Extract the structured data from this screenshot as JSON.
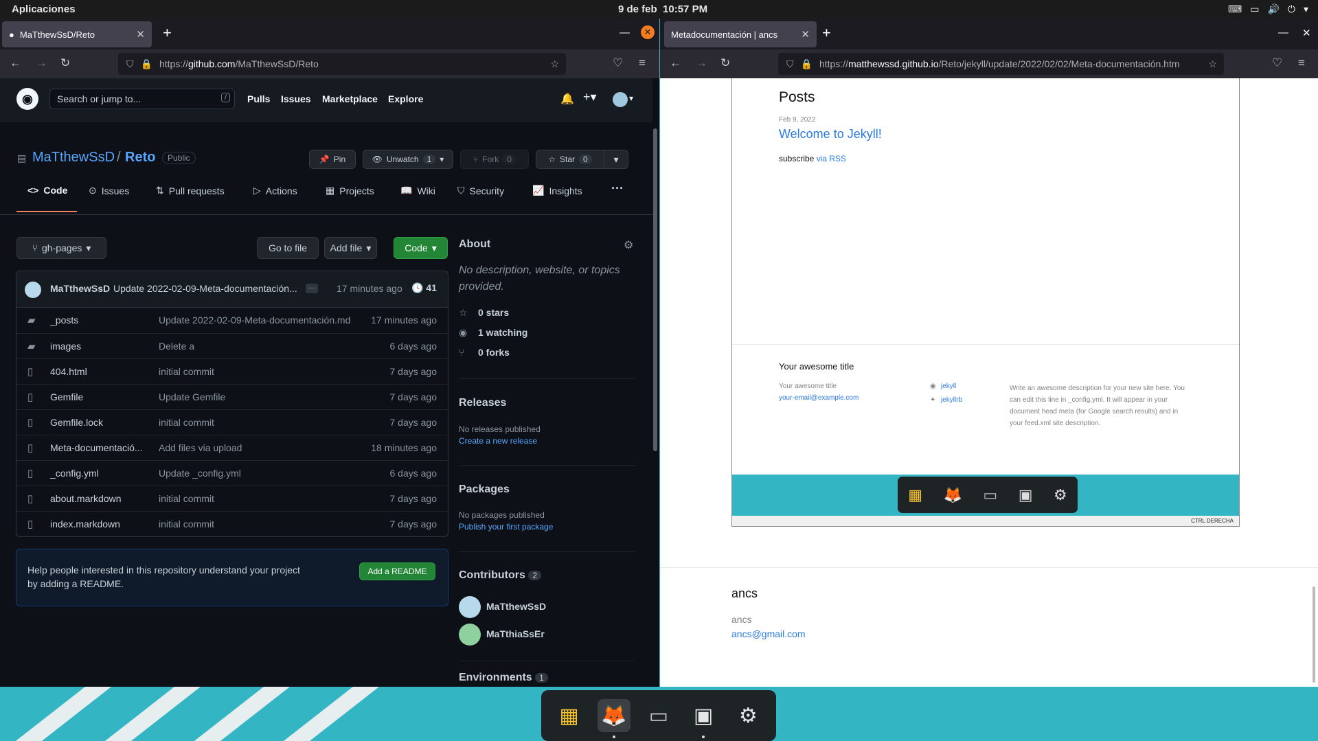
{
  "topbar": {
    "apps": "Aplicaciones",
    "date": "9 de feb",
    "time": "10:57 PM"
  },
  "left_browser": {
    "tab_title": "MaTthewSsD/Reto",
    "url_prefix": "https://",
    "url_host": "github.com",
    "url_path": "/MaTthewSsD/Reto"
  },
  "right_browser": {
    "tab_title": "Metadocumentación | ancs",
    "url_prefix": "https://",
    "url_host": "matthewssd.github.io",
    "url_path": "/Reto/jekyll/update/2022/02/02/Meta-documentación.htm"
  },
  "github": {
    "search_placeholder": "Search or jump to...",
    "search_key": "/",
    "nav": [
      "Pulls",
      "Issues",
      "Marketplace",
      "Explore"
    ],
    "owner": "MaTthewSsD",
    "repo": "Reto",
    "visibility": "Public",
    "pin": "Pin",
    "unwatch": "Unwatch",
    "unwatch_count": "1",
    "fork": "Fork",
    "fork_count": "0",
    "star": "Star",
    "star_count": "0",
    "tabs": [
      "Code",
      "Issues",
      "Pull requests",
      "Actions",
      "Projects",
      "Wiki",
      "Security",
      "Insights"
    ],
    "more": "···",
    "branch": "gh-pages",
    "goto_file": "Go to file",
    "add_file": "Add file",
    "code": "Code",
    "commit": {
      "author": "MaTthewSsD",
      "message": "Update 2022-02-09-Meta-documentación...",
      "dots": "···",
      "age": "17 minutes ago",
      "count": "41"
    },
    "files": [
      {
        "type": "folder",
        "name": "_posts",
        "message": "Update 2022-02-09-Meta-documentación.md",
        "age": "17 minutes ago"
      },
      {
        "type": "folder",
        "name": "images",
        "message": "Delete a",
        "age": "6 days ago"
      },
      {
        "type": "file",
        "name": "404.html",
        "message": "initial commit",
        "age": "7 days ago"
      },
      {
        "type": "file",
        "name": "Gemfile",
        "message": "Update Gemfile",
        "age": "7 days ago"
      },
      {
        "type": "file",
        "name": "Gemfile.lock",
        "message": "initial commit",
        "age": "7 days ago"
      },
      {
        "type": "file",
        "name": "Meta-documentació...",
        "message": "Add files via upload",
        "age": "18 minutes ago"
      },
      {
        "type": "file",
        "name": "_config.yml",
        "message": "Update _config.yml",
        "age": "6 days ago"
      },
      {
        "type": "file",
        "name": "about.markdown",
        "message": "initial commit",
        "age": "7 days ago"
      },
      {
        "type": "file",
        "name": "index.markdown",
        "message": "initial commit",
        "age": "7 days ago"
      }
    ],
    "readme_prompt": "Help people interested in this repository understand your project by adding a README.",
    "add_readme": "Add a README",
    "about": {
      "title": "About",
      "description": "No description, website, or topics provided.",
      "stars": "0 stars",
      "watching": "1 watching",
      "forks": "0 forks"
    },
    "releases": {
      "title": "Releases",
      "none": "No releases published",
      "link": "Create a new release"
    },
    "packages": {
      "title": "Packages",
      "none": "No packages published",
      "link": "Publish your first package"
    },
    "contributors": {
      "title": "Contributors",
      "count": "2",
      "people": [
        "MaTthewSsD",
        "MaTthiaSsEr"
      ]
    },
    "environments": {
      "title": "Environments",
      "count": "1"
    }
  },
  "jekyll": {
    "posts_title": "Posts",
    "post_date": "Feb 9, 2022",
    "post_title": "Welcome to Jekyll!",
    "subscribe": "subscribe",
    "via_rss": "via RSS",
    "footer_title": "Your awesome title",
    "footer_name": "Your awesome title",
    "footer_email": "your-email@example.com",
    "github_user": "jekyll",
    "twitter_user": "jekyllrb",
    "footer_desc": "Write an awesome description for your new site here. You can edit this line in _config.yml. It will appear in your document head meta (for Google search results) and in your feed.xml site description.",
    "vm_status": "CTRL DERECHA",
    "site_title": "ancs",
    "site_name": "ancs",
    "site_email": "ancs@gmail.com"
  },
  "colors": {
    "gh_bg": "#0d1117",
    "gh_link": "#58a6ff",
    "green": "#238636",
    "desktop": "#33b5c4"
  }
}
